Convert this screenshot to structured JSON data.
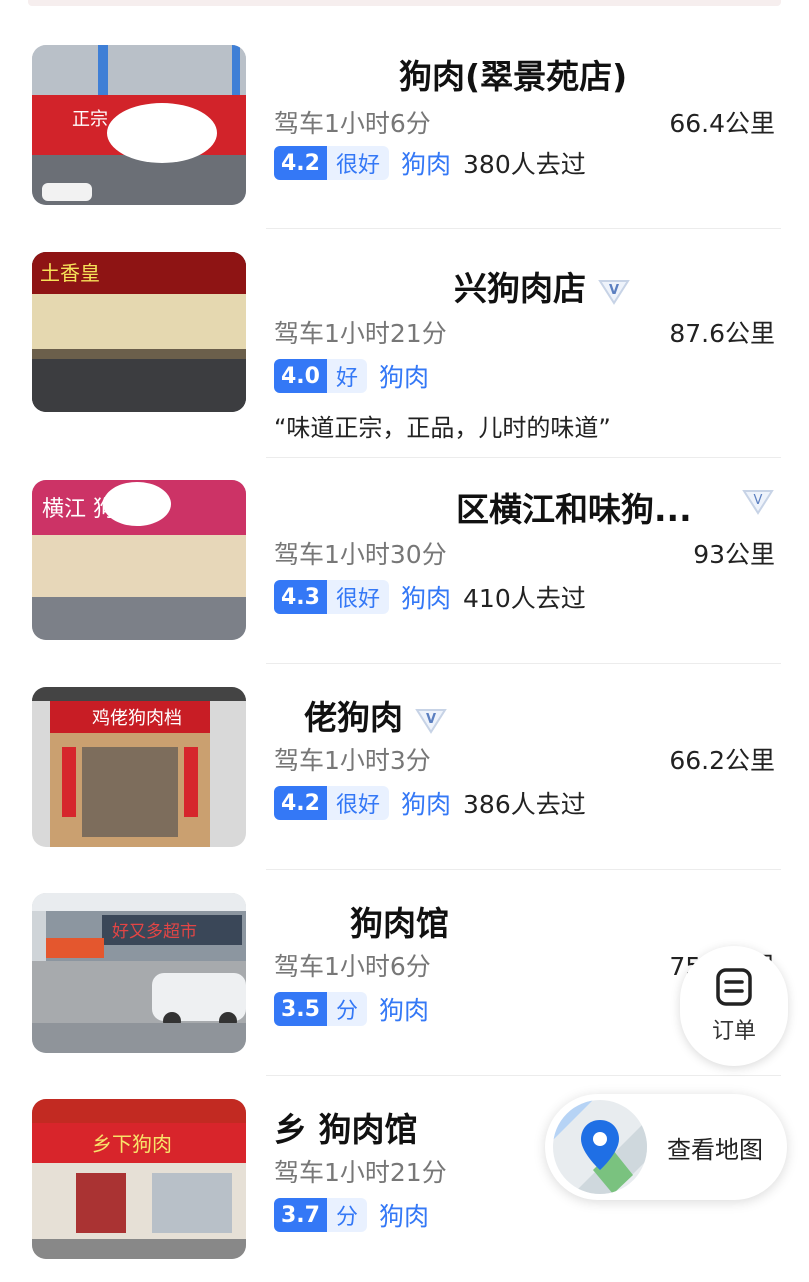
{
  "restaurants": [
    {
      "name": "狗肉(翠景苑店)",
      "drive": "驾车1小时6分",
      "distance": "66.4公里",
      "score": "4.2",
      "level": "很好",
      "category": "狗肉",
      "visits": "380人去过",
      "sign_text": "正宗"
    },
    {
      "name": "兴狗肉店",
      "drive": "驾车1小时21分",
      "distance": "87.6公里",
      "score": "4.0",
      "level": "好",
      "category": "狗肉",
      "review": "“味道正宗，正品，儿时的味道”",
      "sign_text": "土香皇"
    },
    {
      "name": "区横江和味狗...",
      "drive": "驾车1小时30分",
      "distance": "93公里",
      "score": "4.3",
      "level": "很好",
      "category": "狗肉",
      "visits": "410人去过",
      "sign_text": "横江 狗肉"
    },
    {
      "name": "佬狗肉",
      "drive": "驾车1小时3分",
      "distance": "66.2公里",
      "score": "4.2",
      "level": "很好",
      "category": "狗肉",
      "visits": "386人去过",
      "sign_text": "鸡佬狗肉档"
    },
    {
      "name": "狗肉馆",
      "drive": "驾车1小时6分",
      "distance": "75.9公里",
      "score": "3.5",
      "level": "分",
      "category": "狗肉",
      "sign_text": "好又多超市"
    },
    {
      "name": "乡  狗肉馆",
      "drive": "驾车1小时21分",
      "score": "3.7",
      "level": "分",
      "category": "狗肉",
      "sign_text": "乡下狗肉"
    }
  ],
  "floating": {
    "order_label": "订单",
    "map_label": "查看地图"
  },
  "colors": {
    "accent": "#3478f6",
    "accent_light": "#e9f1ff"
  }
}
